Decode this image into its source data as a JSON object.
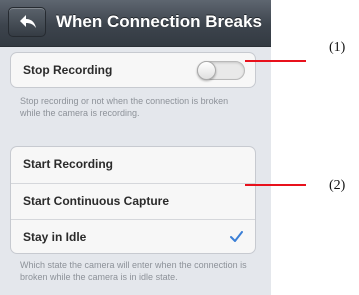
{
  "header": {
    "title": "When Connection Breaks",
    "back_icon": "back-arrow-icon"
  },
  "stop_recording": {
    "label": "Stop Recording",
    "toggle_on": false,
    "footnote": "Stop recording or not when the connection is broken while the camera is recording."
  },
  "idle_options": {
    "items": [
      {
        "label": "Start Recording",
        "selected": false
      },
      {
        "label": "Start Continuous Capture",
        "selected": false
      },
      {
        "label": "Stay in Idle",
        "selected": true
      }
    ],
    "footnote": "Which state the camera will enter when the connection is broken while the camera is in idle state."
  },
  "annotations": {
    "callout_1": "(1)",
    "callout_2": "(2)",
    "line_color": "#e8111c"
  },
  "colors": {
    "checkmark": "#3b7fd6"
  }
}
